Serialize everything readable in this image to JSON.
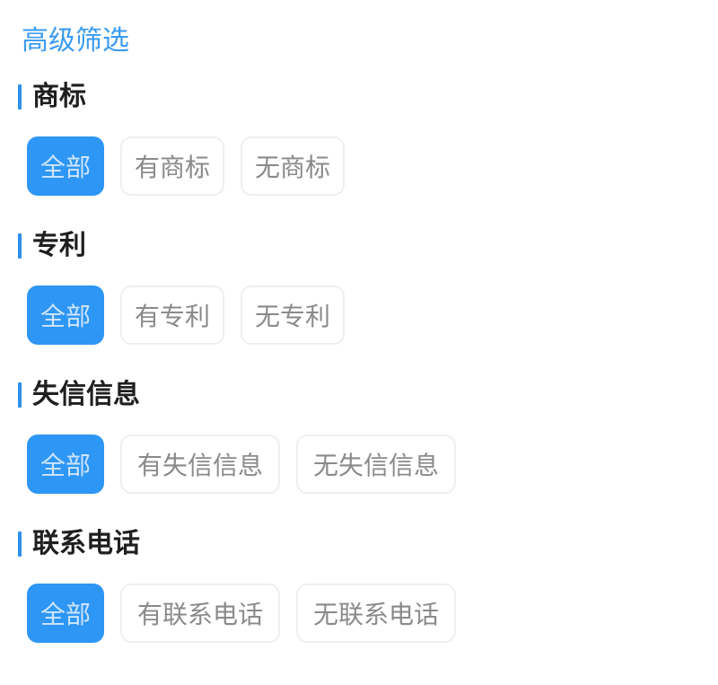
{
  "title": "高级筛选",
  "accent_color": "#3a9bf0",
  "sections": [
    {
      "label": "商标",
      "options": [
        "全部",
        "有商标",
        "无商标"
      ],
      "selected": 0
    },
    {
      "label": "专利",
      "options": [
        "全部",
        "有专利",
        "无专利"
      ],
      "selected": 0
    },
    {
      "label": "失信信息",
      "options": [
        "全部",
        "有失信信息",
        "无失信信息"
      ],
      "selected": 0
    },
    {
      "label": "联系电话",
      "options": [
        "全部",
        "有联系电话",
        "无联系电话"
      ],
      "selected": 0
    }
  ]
}
